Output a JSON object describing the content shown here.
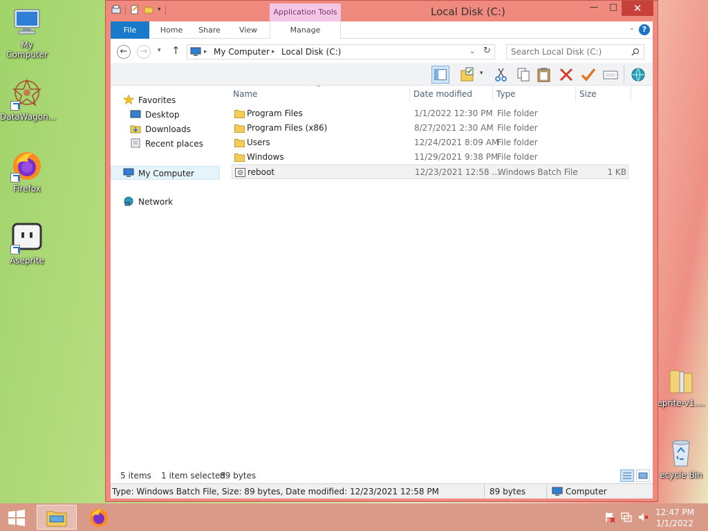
{
  "desktop": {
    "icons": [
      {
        "label": "My Computer"
      },
      {
        "label": "DataWagon..."
      },
      {
        "label": "Firefox"
      },
      {
        "label": "Aseprite"
      },
      {
        "label": "eprite-v1...."
      },
      {
        "label": "ecycle Bin"
      }
    ]
  },
  "window": {
    "title": "Local Disk (C:)",
    "context_tab": "Application Tools",
    "controls": {
      "minimize": "—",
      "maximize": "□",
      "close": "✕"
    },
    "ribbon": {
      "tabs": [
        "File",
        "Home",
        "Share",
        "View",
        "Manage"
      ]
    },
    "address": {
      "crumbs": [
        "My Computer",
        "Local Disk (C:)"
      ],
      "search_placeholder": "Search Local Disk (C:)"
    },
    "nav": {
      "favorites": "Favorites",
      "desktop": "Desktop",
      "downloads": "Downloads",
      "recent": "Recent places",
      "computer": "My Computer",
      "network": "Network"
    },
    "columns": {
      "name": "Name",
      "date": "Date modified",
      "type": "Type",
      "size": "Size"
    },
    "files": [
      {
        "name": "Program Files",
        "date": "1/1/2022 12:30 PM",
        "type": "File folder",
        "size": ""
      },
      {
        "name": "Program Files (x86)",
        "date": "8/27/2021 2:30 AM",
        "type": "File folder",
        "size": ""
      },
      {
        "name": "Users",
        "date": "12/24/2021 8:09 AM",
        "type": "File folder",
        "size": ""
      },
      {
        "name": "Windows",
        "date": "11/29/2021 9:38 PM",
        "type": "File folder",
        "size": ""
      },
      {
        "name": "reboot",
        "date": "12/23/2021 12:58 ...",
        "type": "Windows Batch File",
        "size": "1 KB"
      }
    ],
    "status": {
      "items": "5 items",
      "selected": "1 item selected",
      "bytes": "89 bytes"
    },
    "details": {
      "text": "Type: Windows Batch File, Size: 89 bytes, Date modified: 12/23/2021 12:58 PM",
      "size": "89 bytes",
      "location": "Computer"
    }
  },
  "taskbar": {
    "time": "12:47 PM",
    "date": "1/1/2022"
  },
  "colors": {
    "window_frame": "#f08a7e",
    "file_tab": "#1979ca",
    "close_button": "#c7413a",
    "context_tab": "#f3c6e6"
  }
}
